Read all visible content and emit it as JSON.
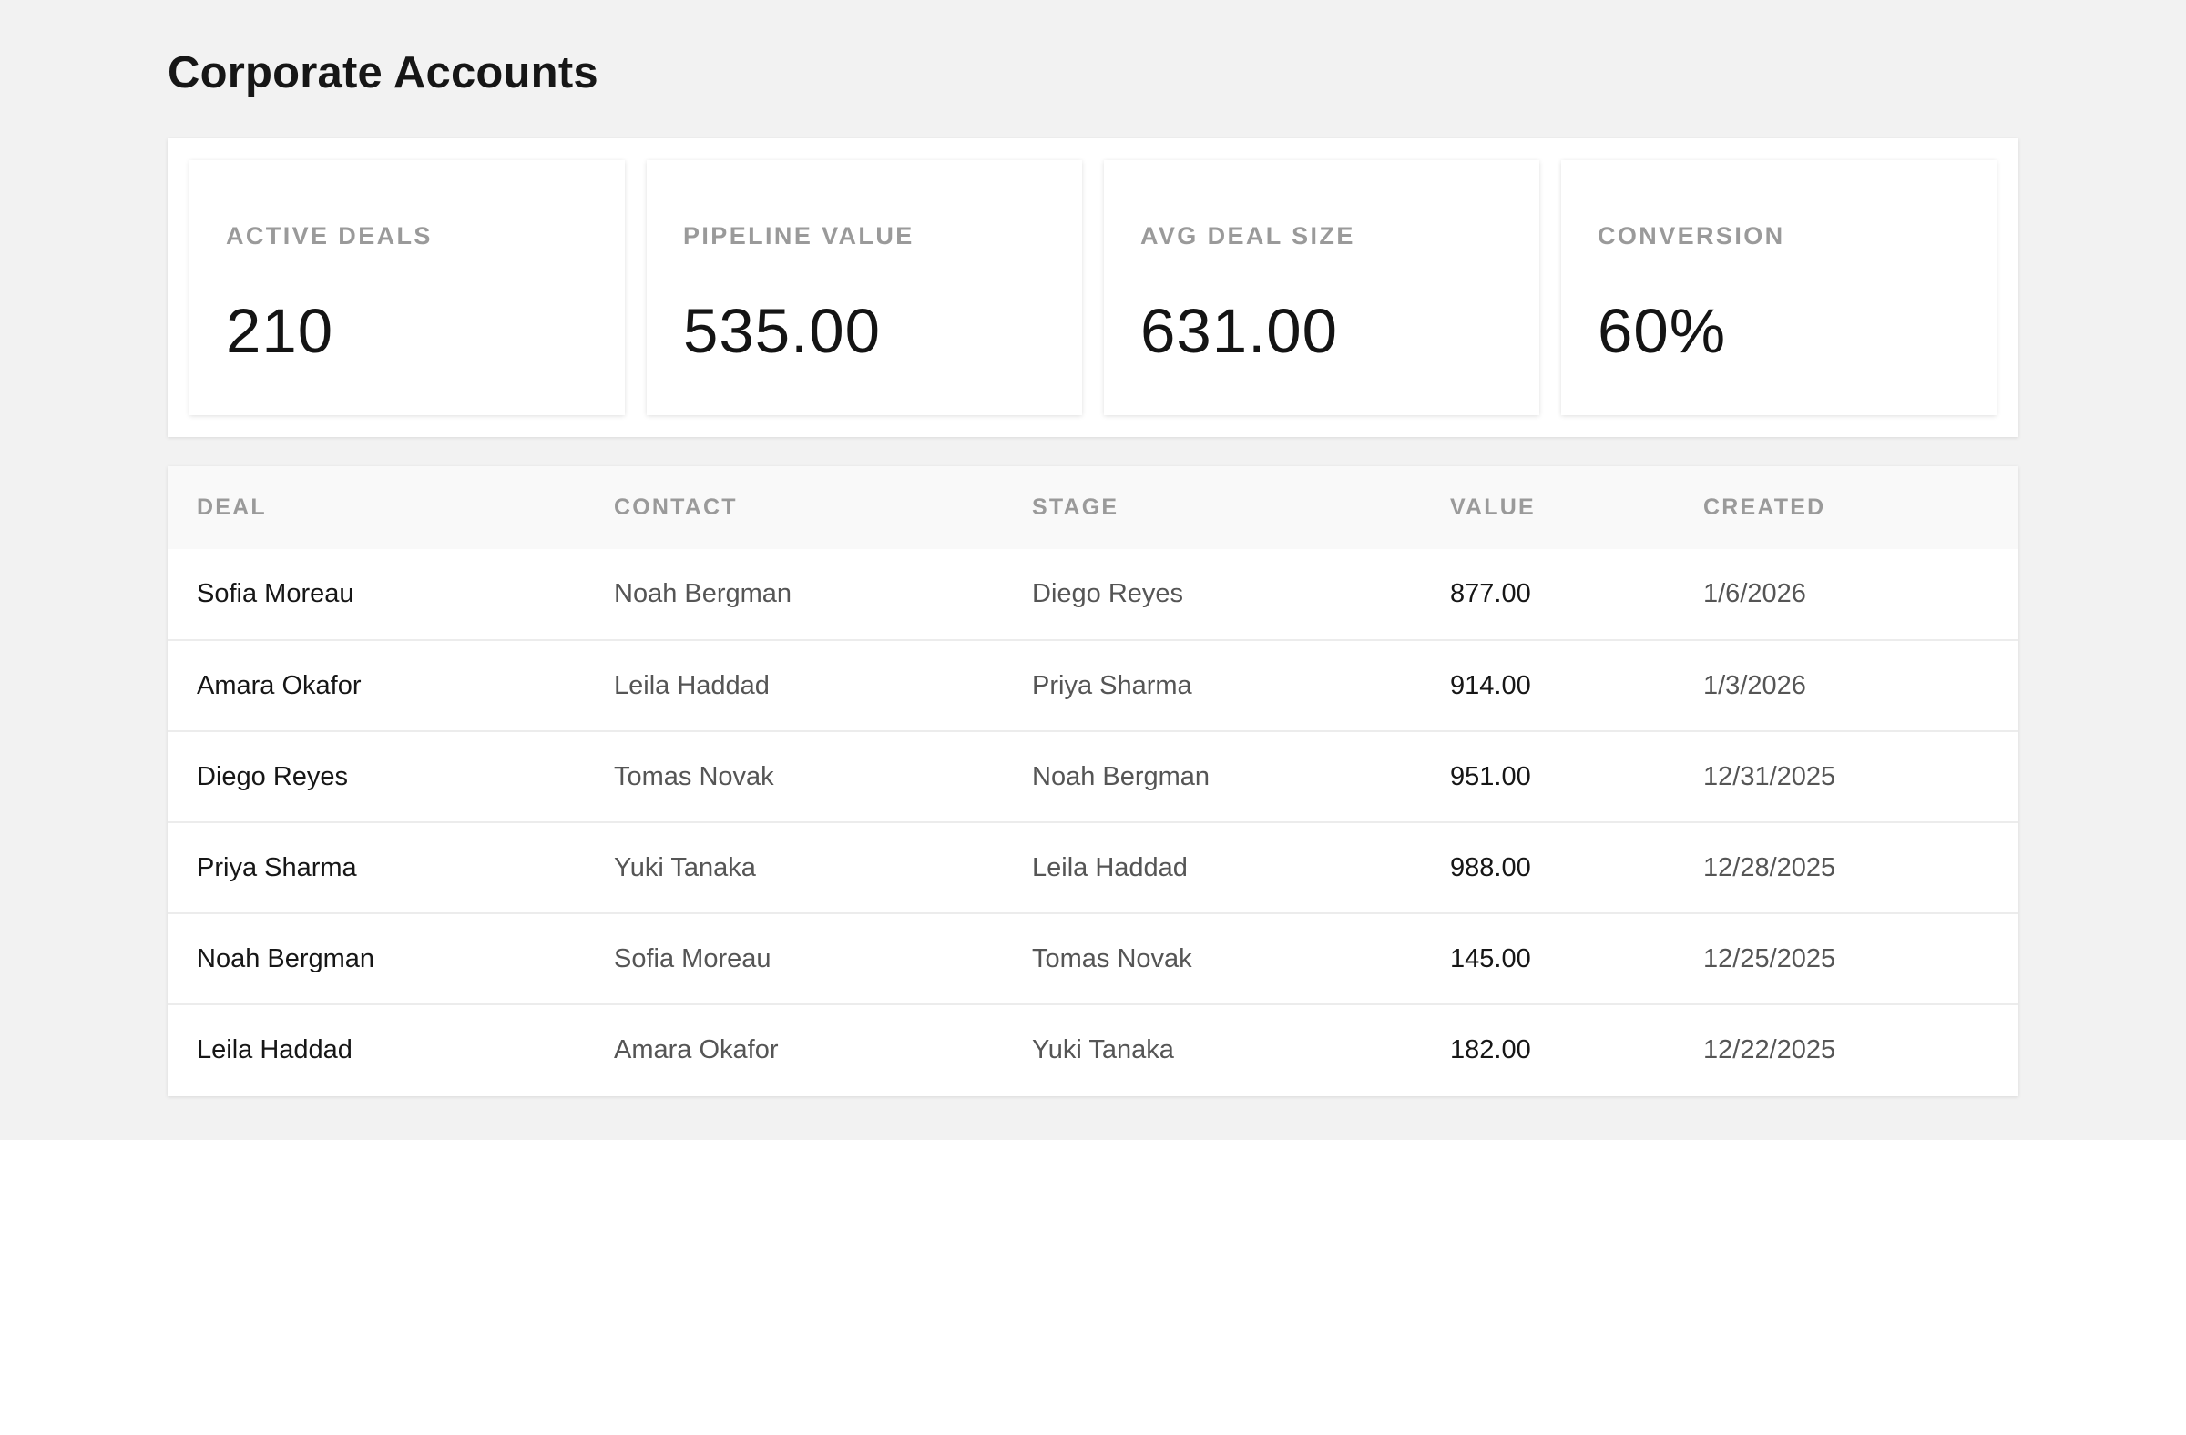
{
  "page": {
    "title": "Corporate Accounts"
  },
  "stats": [
    {
      "label": "ACTIVE DEALS",
      "value": "210"
    },
    {
      "label": "PIPELINE VALUE",
      "value": "535.00"
    },
    {
      "label": "AVG DEAL SIZE",
      "value": "631.00"
    },
    {
      "label": "CONVERSION",
      "value": "60%"
    }
  ],
  "table": {
    "headers": {
      "deal": "DEAL",
      "contact": "CONTACT",
      "stage": "STAGE",
      "value": "VALUE",
      "created": "CREATED"
    },
    "rows": [
      {
        "deal": "Sofia Moreau",
        "contact": "Noah Bergman",
        "stage": "Diego Reyes",
        "value": "877.00",
        "created": "1/6/2026"
      },
      {
        "deal": "Amara Okafor",
        "contact": "Leila Haddad",
        "stage": "Priya Sharma",
        "value": "914.00",
        "created": "1/3/2026"
      },
      {
        "deal": "Diego Reyes",
        "contact": "Tomas Novak",
        "stage": "Noah Bergman",
        "value": "951.00",
        "created": "12/31/2025"
      },
      {
        "deal": "Priya Sharma",
        "contact": "Yuki Tanaka",
        "stage": "Leila Haddad",
        "value": "988.00",
        "created": "12/28/2025"
      },
      {
        "deal": "Noah Bergman",
        "contact": "Sofia Moreau",
        "stage": "Tomas Novak",
        "value": "145.00",
        "created": "12/25/2025"
      },
      {
        "deal": "Leila Haddad",
        "contact": "Amara Okafor",
        "stage": "Yuki Tanaka",
        "value": "182.00",
        "created": "12/22/2025"
      }
    ]
  },
  "colors": {
    "background": "#f2f2f2",
    "card": "#ffffff",
    "text_primary": "#161616",
    "text_secondary": "#555555",
    "text_muted": "#9a9a9a"
  }
}
